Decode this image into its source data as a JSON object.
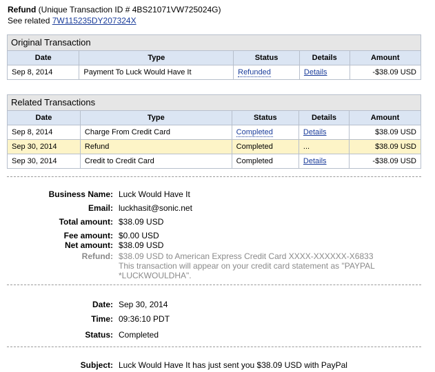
{
  "header": {
    "title_bold": "Refund",
    "title_rest": "(Unique Transaction ID # 4BS21071VW725024G)",
    "see_related_label": "See related",
    "see_related_link": "7W115235DY207324X"
  },
  "columns": [
    "Date",
    "Type",
    "Status",
    "Details",
    "Amount"
  ],
  "original": {
    "title": "Original Transaction",
    "rows": [
      {
        "date": "Sep 8, 2014",
        "type": "Payment To Luck Would Have It",
        "status": "Refunded",
        "details": "Details",
        "amount": "-$38.09 USD"
      }
    ]
  },
  "related": {
    "title": "Related Transactions",
    "rows": [
      {
        "date": "Sep 8, 2014",
        "type": "Charge From Credit Card",
        "status": "Completed",
        "details": "Details",
        "amount": "$38.09 USD"
      },
      {
        "date": "Sep 30, 2014",
        "type": "Refund",
        "status": "Completed",
        "details": "...",
        "amount": "$38.09 USD"
      },
      {
        "date": "Sep 30, 2014",
        "type": "Credit to Credit Card",
        "status": "Completed",
        "details": "Details",
        "amount": "-$38.09 USD"
      }
    ]
  },
  "info": {
    "business_name_label": "Business Name:",
    "business_name": "Luck Would Have It",
    "email_label": "Email:",
    "email": "luckhasit@sonic.net",
    "total_label": "Total amount:",
    "total": "$38.09 USD",
    "fee_label": "Fee amount:",
    "fee": "$0.00 USD",
    "net_label": "Net amount:",
    "net": "$38.09 USD",
    "refund_label": "Refund:",
    "refund_line1": "$38.09 USD to American Express Credit Card XXXX-XXXXXX-X6833",
    "refund_line2": "This transaction will appear on your credit card statement as \"PAYPAL",
    "refund_line3": "*LUCKWOULDHA\"."
  },
  "timing": {
    "date_label": "Date:",
    "date": "Sep 30, 2014",
    "time_label": "Time:",
    "time": "09:36:10 PDT",
    "status_label": "Status:",
    "status": "Completed"
  },
  "subject": {
    "label": "Subject:",
    "value": "Luck Would Have It has just sent you $38.09 USD with PayPal"
  }
}
